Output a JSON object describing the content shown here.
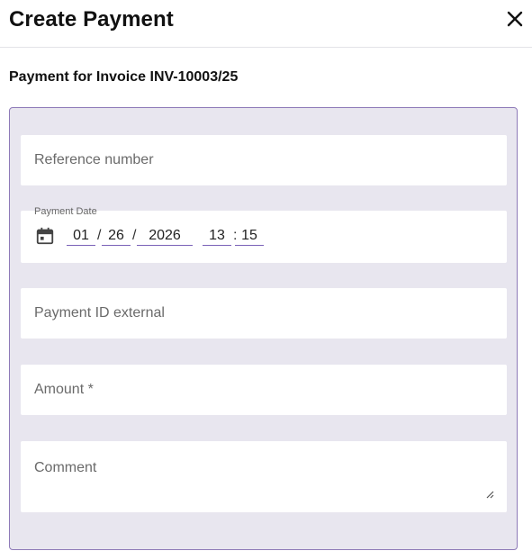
{
  "dialog": {
    "title": "Create Payment",
    "close_icon": "close-icon"
  },
  "subtitle": "Payment for Invoice INV-10003/25",
  "form": {
    "reference_number": {
      "placeholder": "Reference number",
      "value": ""
    },
    "payment_date": {
      "label": "Payment Date",
      "icon": "calendar-icon",
      "month": "01",
      "day": "26",
      "year": "2026",
      "hour": "13",
      "minute": "15",
      "date_separator": "/",
      "time_separator": ":"
    },
    "payment_id_external": {
      "placeholder": "Payment ID external",
      "value": ""
    },
    "amount": {
      "placeholder": "Amount *",
      "value": ""
    },
    "comment": {
      "placeholder": "Comment",
      "value": ""
    }
  },
  "colors": {
    "panel_bg": "#e8e6ef",
    "panel_border": "#8e7ab8",
    "accent_underline": "#7a62b8"
  }
}
